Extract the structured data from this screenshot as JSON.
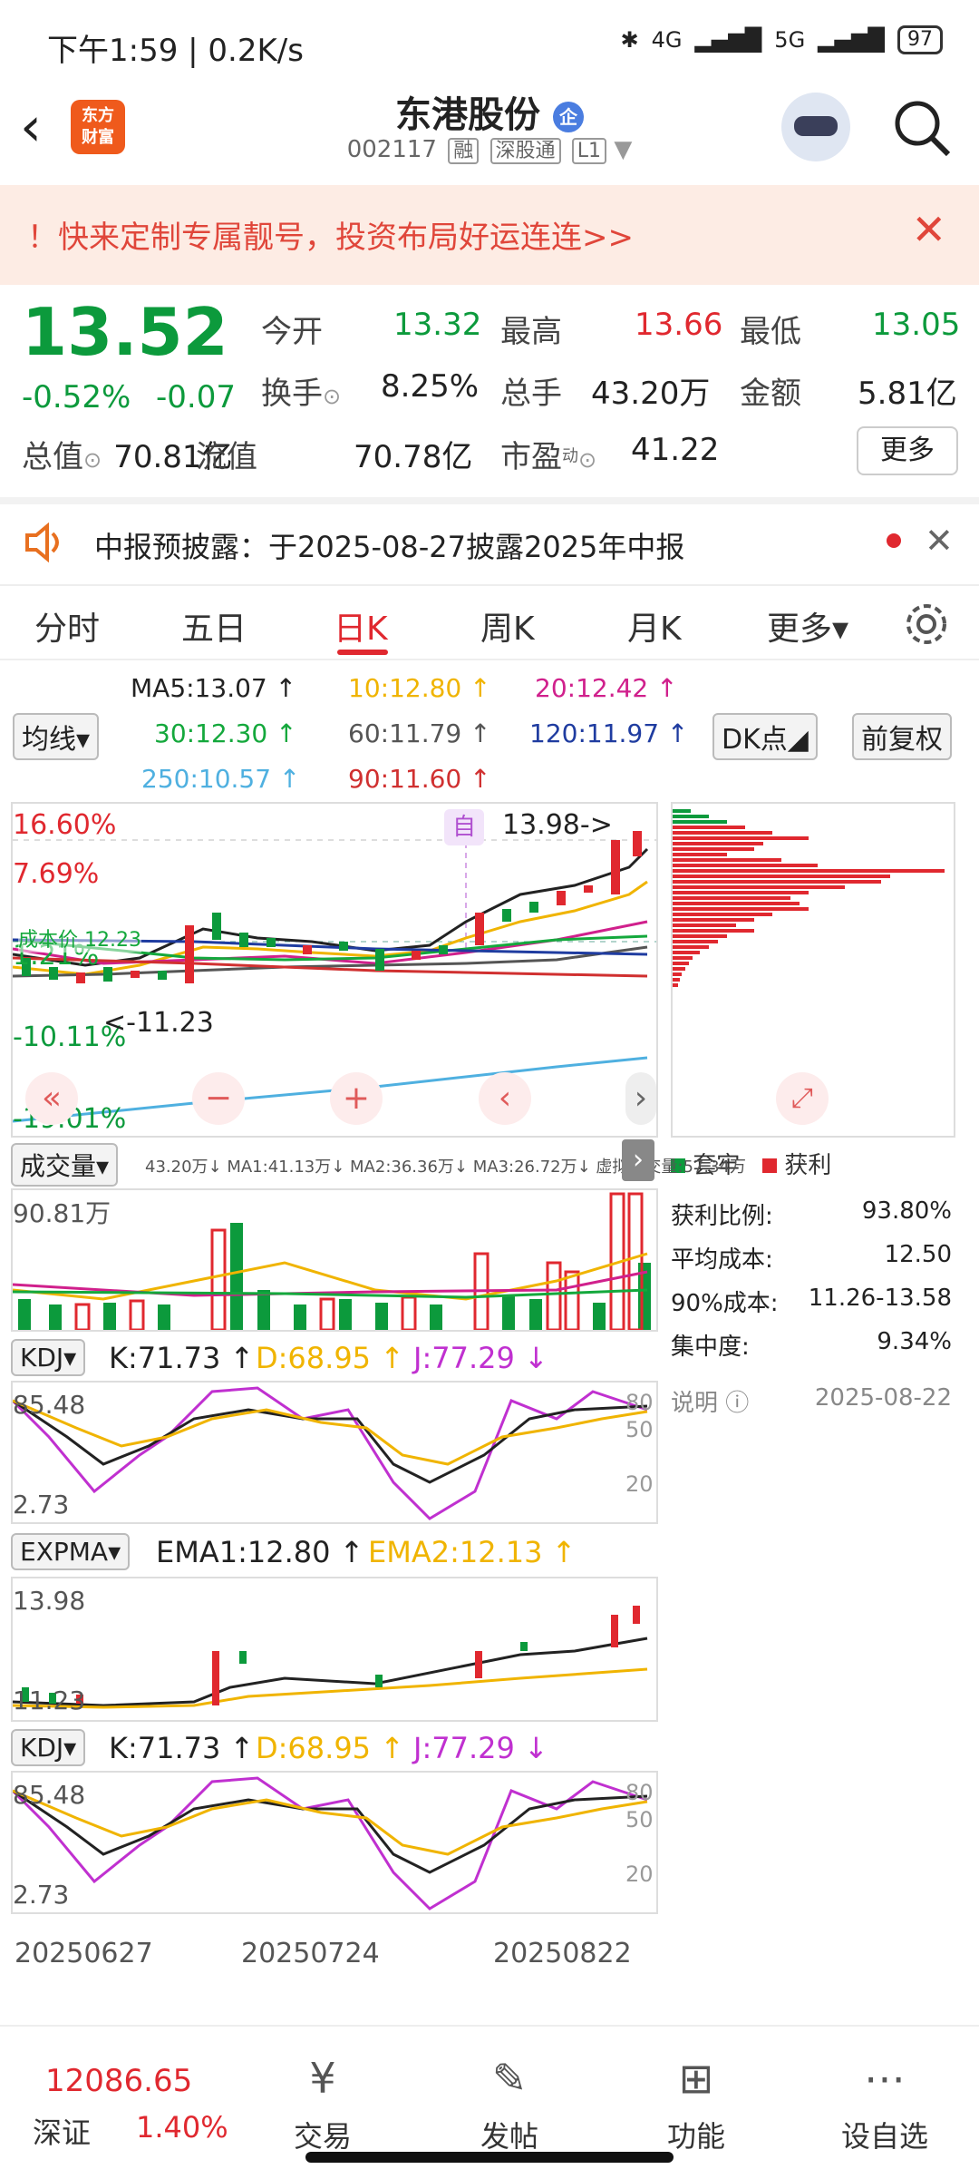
{
  "status_bar": {
    "time": "下午1:59 | 0.2K/s",
    "battery": "97",
    "network1": "4G",
    "network2": "5G"
  },
  "header": {
    "title": "东港股份",
    "badge": "企",
    "code": "002117",
    "tags": [
      "融",
      "深股通",
      "L1"
    ],
    "logo_line1": "东方",
    "logo_line2": "财富"
  },
  "banner": {
    "text": "！快来定制专属靓号，投资布局好运连连>>"
  },
  "quote": {
    "price": "13.52",
    "change_pct": "-0.52%",
    "change": "-0.07",
    "open_label": "今开",
    "open": "13.32",
    "high_label": "最高",
    "high": "13.66",
    "low_label": "最低",
    "low": "13.05",
    "turnover_label": "换手",
    "turnover": "8.25%",
    "volume_label": "总手",
    "volume": "43.20万",
    "amount_label": "金额",
    "amount": "5.81亿",
    "mktcap_label": "总值",
    "mktcap": "70.81亿",
    "float_label": "流值",
    "float": "70.78亿",
    "pe_label": "市盈",
    "pe_sup": "动",
    "pe": "41.22",
    "more": "更多"
  },
  "notice": {
    "text": "中报预披露：于2025-08-27披露2025年中报"
  },
  "tabs": [
    "分时",
    "五日",
    "日K",
    "周K",
    "月K",
    "更多▾"
  ],
  "ma_row": {
    "selector": "均线▾",
    "ma5": "MA5:13.07 ↑",
    "ma10": "10:12.80 ↑",
    "ma20": "20:12.42 ↑",
    "ma30": "30:12.30 ↑",
    "ma60": "60:11.79 ↑",
    "ma120": "120:11.97 ↑",
    "ma250": "250:10.57 ↑",
    "ma90": "90:11.60 ↑",
    "dk": "DK点◢",
    "adjust": "前复权",
    "colors": {
      "ma5": "#222222",
      "ma10": "#f0b400",
      "ma20": "#d0208c",
      "ma30": "#14a83c",
      "ma60": "#555555",
      "ma120": "#1f3ca0",
      "ma250": "#4fb0e0",
      "ma90": "#d03030"
    }
  },
  "kchart": {
    "pct_labels": [
      "16.60%",
      "7.69%",
      "1.21%",
      "-10.11%",
      "-19.01%"
    ],
    "peak_label": "13.98->",
    "low_label": "<-11.23",
    "cost_label": "成本价 12.23",
    "self_tag": "自",
    "controls": [
      "«",
      "−",
      "+",
      "‹",
      "›"
    ]
  },
  "chip": {
    "legend_trapped": "套牢",
    "legend_profit": "获利",
    "rows": [
      {
        "label": "获利比例:",
        "value": "93.80%"
      },
      {
        "label": "平均成本:",
        "value": "12.50"
      },
      {
        "label": "90%成本:",
        "value": "11.26-13.58"
      },
      {
        "label": "集中度:",
        "value": "9.34%"
      }
    ],
    "note_label": "说明",
    "date": "2025-08-22"
  },
  "volume": {
    "selector": "成交量▾",
    "info": "43.20万↓  MA1:41.13万↓  MA2:36.36万↓  MA3:26.72万↓  虚拟成交量:57.34万",
    "max_label": "90.81万"
  },
  "kdj1": {
    "selector": "KDJ▾",
    "k": "K:71.73 ↑",
    "d": "D:68.95 ↑",
    "j": "J:77.29 ↓",
    "top": "85.48",
    "bottom": "2.73",
    "lv80": "80",
    "lv50": "50",
    "lv20": "20"
  },
  "expma": {
    "selector": "EXPMA▾",
    "ema1": "EMA1:12.80 ↑",
    "ema2": "EMA2:12.13 ↑",
    "top": "13.98",
    "bottom": "11.23"
  },
  "kdj2": {
    "selector": "KDJ▾",
    "k": "K:71.73 ↑",
    "d": "D:68.95 ↑",
    "j": "J:77.29 ↓",
    "top": "85.48",
    "bottom": "2.73",
    "lv80": "80",
    "lv50": "50",
    "lv20": "20"
  },
  "dates": [
    "20250627",
    "20250724",
    "20250822"
  ],
  "bottom_nav": {
    "index_value": "12086.65",
    "index_name": "深证",
    "index_change": "1.40%",
    "items": [
      "交易",
      "发帖",
      "功能",
      "设自选"
    ]
  }
}
